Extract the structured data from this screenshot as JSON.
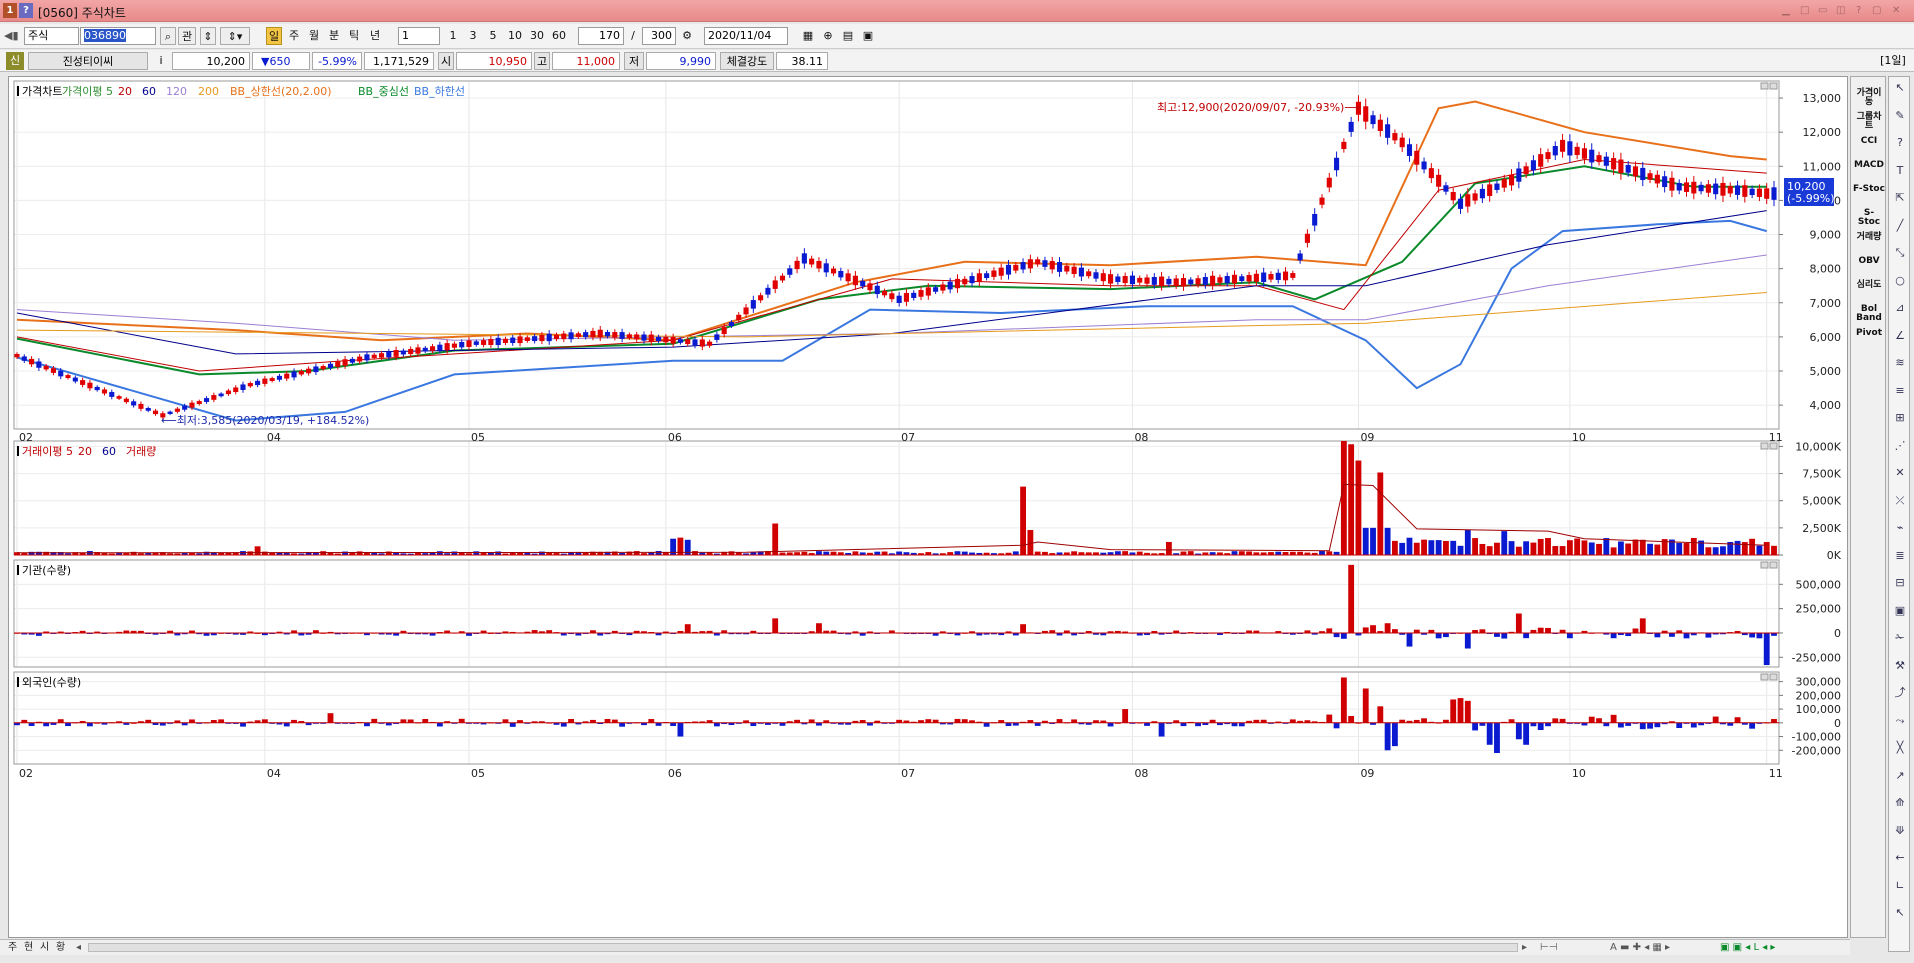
{
  "window": {
    "number": "1",
    "help": "?",
    "title": "[0560] 주식차트"
  },
  "toolbar": {
    "market": "주식",
    "code": "036890",
    "buttons": [
      "관"
    ],
    "periods": [
      "일",
      "주",
      "월",
      "분",
      "틱",
      "년"
    ],
    "unit_value": "1",
    "unit_buttons": [
      "1",
      "3",
      "5",
      "10",
      "30",
      "60"
    ],
    "count": "170",
    "count_total": "300",
    "date": "2020/11/04"
  },
  "quote": {
    "badge": "신",
    "name": "진성티이씨",
    "info": "i",
    "price": "10,200",
    "change": "▼650",
    "change_pct": "-5.99%",
    "volume": "1,171,529",
    "open_label": "시",
    "open": "10,950",
    "high_label": "고",
    "high": "11,000",
    "low_label": "저",
    "low": "9,990",
    "strength_label": "체결강도",
    "strength": "38.11",
    "period_tag": "[1일]"
  },
  "legend": {
    "price": [
      {
        "text": "가격차트",
        "color": "#000000"
      },
      {
        "text": "가격이평 5",
        "color": "#2f8f2f"
      },
      {
        "text": "20",
        "color": "#c00000"
      },
      {
        "text": "60",
        "color": "#00008b"
      },
      {
        "text": "120",
        "color": "#9b7fd4"
      },
      {
        "text": "200",
        "color": "#e69a1e"
      },
      {
        "text": "BB_상한선(20,2.00)",
        "color": "#e8701a"
      },
      {
        "text": "BB_중심선",
        "color": "#0a8a2a"
      },
      {
        "text": "BB_하한선",
        "color": "#3a78e0"
      }
    ],
    "volume": [
      {
        "text": "거래이평 5",
        "color": "#c00000"
      },
      {
        "text": "20",
        "color": "#c00000"
      },
      {
        "text": "60",
        "color": "#00008b"
      },
      {
        "text": "거래량",
        "color": "#c00000"
      }
    ],
    "institution": "기관(수량)",
    "foreign": "외국인(수량)"
  },
  "annotations": {
    "high": "최고:12,900(2020/09/07, -20.93%)⟶",
    "low": "⟵최저:3,585(2020/03/19, +184.52%)",
    "current_price": "10,200",
    "current_pct": "(-5.99%)"
  },
  "right_panel": [
    "가격이동",
    "그룹차트",
    "CCI",
    "MACD",
    "F-Stoc",
    "S-Stoc",
    "거래량",
    "OBV",
    "심리도",
    "Bol Band",
    "Pivot"
  ],
  "bottom": {
    "tabs": [
      "주",
      "현",
      "시",
      "황"
    ]
  },
  "chart_data": [
    {
      "type": "candlestick",
      "title": "가격차트",
      "x_ticks": [
        "02",
        "04",
        "05",
        "06",
        "07",
        "08",
        "09",
        "10",
        "11"
      ],
      "y_ticks": [
        "4,000",
        "5,000",
        "6,000",
        "7,000",
        "8,000",
        "9,000",
        "10,000",
        "11,000",
        "12,000",
        "13,000"
      ],
      "ylim": [
        3300,
        13500
      ],
      "series_colors": {
        "up": "#e00000",
        "down": "#0a1ad0"
      },
      "anchors": {
        "x_index": [
          0,
          34,
          62,
          89,
          121,
          153,
          184,
          213,
          240
        ],
        "price": [
          5450,
          3700,
          4600,
          5400,
          5800,
          6100,
          5800,
          8300,
          7100,
          8200,
          7700,
          7600,
          7800,
          12700,
          11700,
          9900,
          10600,
          11600,
          11000,
          10400,
          10300,
          10200
        ]
      },
      "anchor_x": [
        0,
        20,
        32,
        48,
        62,
        80,
        95,
        108,
        121,
        140,
        150,
        160,
        175,
        184,
        190,
        198,
        205,
        212,
        220,
        228,
        236,
        240
      ],
      "overlays": {
        "bb_upper": [
          [
            0,
            6500
          ],
          [
            30,
            6200
          ],
          [
            50,
            5900
          ],
          [
            70,
            6100
          ],
          [
            90,
            5900
          ],
          [
            115,
            7600
          ],
          [
            130,
            8200
          ],
          [
            150,
            8100
          ],
          [
            170,
            8350
          ],
          [
            185,
            8100
          ],
          [
            195,
            12700
          ],
          [
            200,
            12900
          ],
          [
            215,
            12000
          ],
          [
            235,
            11300
          ],
          [
            240,
            11200
          ]
        ],
        "bb_middle": [
          [
            0,
            5950
          ],
          [
            25,
            4900
          ],
          [
            40,
            5000
          ],
          [
            60,
            5600
          ],
          [
            90,
            5800
          ],
          [
            110,
            7100
          ],
          [
            125,
            7500
          ],
          [
            150,
            7400
          ],
          [
            170,
            7600
          ],
          [
            178,
            7100
          ],
          [
            190,
            8200
          ],
          [
            200,
            10500
          ],
          [
            215,
            11000
          ],
          [
            230,
            10400
          ],
          [
            240,
            10400
          ]
        ],
        "bb_lower": [
          [
            0,
            5400
          ],
          [
            30,
            3550
          ],
          [
            45,
            3800
          ],
          [
            60,
            4900
          ],
          [
            90,
            5300
          ],
          [
            105,
            5300
          ],
          [
            117,
            6800
          ],
          [
            135,
            6700
          ],
          [
            155,
            6900
          ],
          [
            175,
            6900
          ],
          [
            185,
            5900
          ],
          [
            192,
            4500
          ],
          [
            198,
            5200
          ],
          [
            205,
            8000
          ],
          [
            212,
            9100
          ],
          [
            225,
            9300
          ],
          [
            235,
            9400
          ],
          [
            240,
            9100
          ]
        ],
        "ma20": [
          [
            0,
            6000
          ],
          [
            25,
            5000
          ],
          [
            45,
            5300
          ],
          [
            90,
            5900
          ],
          [
            120,
            7700
          ],
          [
            150,
            7500
          ],
          [
            170,
            7500
          ],
          [
            182,
            6800
          ],
          [
            195,
            10300
          ],
          [
            215,
            11200
          ],
          [
            240,
            10800
          ]
        ],
        "ma60": [
          [
            0,
            6700
          ],
          [
            30,
            5500
          ],
          [
            60,
            5600
          ],
          [
            90,
            5700
          ],
          [
            120,
            6100
          ],
          [
            170,
            7500
          ],
          [
            185,
            7500
          ],
          [
            210,
            8700
          ],
          [
            240,
            9700
          ]
        ],
        "ma120": [
          [
            0,
            6800
          ],
          [
            30,
            6400
          ],
          [
            60,
            5900
          ],
          [
            120,
            6100
          ],
          [
            170,
            6500
          ],
          [
            185,
            6500
          ],
          [
            210,
            7500
          ],
          [
            240,
            8400
          ]
        ],
        "ma200": [
          [
            0,
            6200
          ],
          [
            100,
            6000
          ],
          [
            185,
            6400
          ],
          [
            240,
            7300
          ]
        ]
      }
    },
    {
      "type": "bar",
      "title": "거래량",
      "y_ticks": [
        "10,000K",
        "7,500K",
        "5,000K",
        "2,500K",
        "0K"
      ],
      "ylim": [
        0,
        10500000
      ],
      "spikes": [
        {
          "i": 33,
          "v": 800000
        },
        {
          "i": 90,
          "v": 1500000
        },
        {
          "i": 91,
          "v": 1600000
        },
        {
          "i": 92,
          "v": 1400000
        },
        {
          "i": 104,
          "v": 2900000
        },
        {
          "i": 138,
          "v": 6300000
        },
        {
          "i": 139,
          "v": 2300000
        },
        {
          "i": 158,
          "v": 1200000
        },
        {
          "i": 182,
          "v": 10500000
        },
        {
          "i": 183,
          "v": 10200000
        },
        {
          "i": 184,
          "v": 8700000
        },
        {
          "i": 185,
          "v": 2500000
        },
        {
          "i": 186,
          "v": 2500000
        },
        {
          "i": 187,
          "v": 7600000
        },
        {
          "i": 188,
          "v": 2500000
        },
        {
          "i": 199,
          "v": 2300000
        },
        {
          "i": 204,
          "v": 2200000
        },
        {
          "i": 240,
          "v": 1200000
        }
      ]
    },
    {
      "type": "bar",
      "title": "기관(수량)",
      "y_ticks": [
        "500,000",
        "250,000",
        "0",
        "-250,000"
      ],
      "ylim": [
        -350000,
        750000
      ],
      "spikes": [
        {
          "i": 92,
          "v": 90000
        },
        {
          "i": 104,
          "v": 150000
        },
        {
          "i": 110,
          "v": 100000
        },
        {
          "i": 138,
          "v": 90000
        },
        {
          "i": 182,
          "v": -60000
        },
        {
          "i": 183,
          "v": 700000
        },
        {
          "i": 186,
          "v": 80000
        },
        {
          "i": 188,
          "v": 100000
        },
        {
          "i": 191,
          "v": -140000
        },
        {
          "i": 199,
          "v": -160000
        },
        {
          "i": 206,
          "v": 200000
        },
        {
          "i": 223,
          "v": 150000
        },
        {
          "i": 240,
          "v": -330000
        }
      ]
    },
    {
      "type": "bar",
      "title": "외국인(수량)",
      "y_ticks": [
        "300,000",
        "200,000",
        "100,000",
        "0",
        "-100,000",
        "-200,000"
      ],
      "ylim": [
        -300000,
        370000
      ],
      "spikes": [
        {
          "i": 43,
          "v": 70000
        },
        {
          "i": 91,
          "v": -100000
        },
        {
          "i": 152,
          "v": 100000
        },
        {
          "i": 157,
          "v": -100000
        },
        {
          "i": 182,
          "v": 330000
        },
        {
          "i": 185,
          "v": 250000
        },
        {
          "i": 187,
          "v": 120000
        },
        {
          "i": 188,
          "v": -200000
        },
        {
          "i": 189,
          "v": -170000
        },
        {
          "i": 197,
          "v": 170000
        },
        {
          "i": 198,
          "v": 180000
        },
        {
          "i": 199,
          "v": 160000
        },
        {
          "i": 202,
          "v": -160000
        },
        {
          "i": 203,
          "v": -220000
        },
        {
          "i": 206,
          "v": -120000
        },
        {
          "i": 207,
          "v": -160000
        }
      ]
    }
  ]
}
